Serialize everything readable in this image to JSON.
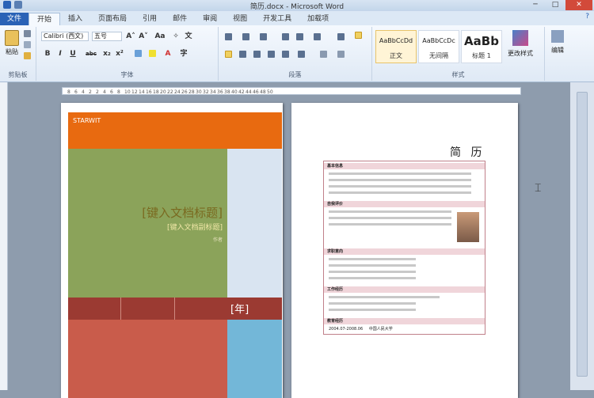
{
  "window": {
    "title": "简历.docx - Microsoft Word",
    "minimize": "─",
    "maximize": "□",
    "close": "✕"
  },
  "tabs": [
    "文件",
    "开始",
    "插入",
    "页面布局",
    "引用",
    "邮件",
    "审阅",
    "视图",
    "开发工具",
    "加载项"
  ],
  "active_tab": "开始",
  "help": "?",
  "ribbon": {
    "clipboard": {
      "label": "剪贴板",
      "paste": "粘贴"
    },
    "font": {
      "label": "字体",
      "font_name": "Calibri (西文)",
      "font_size": "五号",
      "bold": "B",
      "italic": "I",
      "underline": "U",
      "strike": "abc",
      "sub": "x₂",
      "sup": "x²",
      "grow": "A˄",
      "shrink": "A˅",
      "case": "Aa",
      "clear": "✧",
      "wen": "文",
      "font_color": "A",
      "circle": "字"
    },
    "paragraph": {
      "label": "段落"
    },
    "styles": {
      "label": "样式",
      "items": [
        {
          "preview": "AaBbCcDd",
          "name": "正文"
        },
        {
          "preview": "AaBbCcDc",
          "name": "无间隔"
        },
        {
          "preview": "AaBb",
          "name": "标题 1"
        }
      ],
      "change": "更改样式"
    },
    "editing": {
      "label": "编辑"
    }
  },
  "ruler": [
    "8",
    "6",
    "4",
    "2",
    "2",
    "4",
    "6",
    "8",
    "10",
    "12",
    "14",
    "16",
    "18",
    "20",
    "22",
    "24",
    "26",
    "28",
    "30",
    "32",
    "34",
    "36",
    "38",
    "40",
    "42",
    "44",
    "46",
    "48",
    "50"
  ],
  "cover": {
    "company": "STARWIT",
    "title": "[键入文档标题]",
    "subtitle": "[键入文档副标题]",
    "author": "作者",
    "year": "[年]"
  },
  "resume": {
    "title": "简  历",
    "sections": [
      "基本信息",
      "自我评价",
      "求职意向",
      "工作经历",
      "教育经历"
    ],
    "date": "2004.07-2008.06",
    "school": "中国人民大学"
  }
}
